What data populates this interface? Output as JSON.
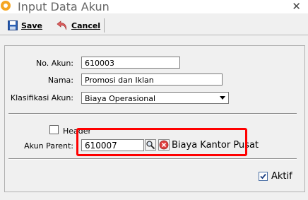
{
  "window": {
    "title": "Input Data Akun",
    "close_glyph": "✕"
  },
  "toolbar": {
    "save_label": "Save",
    "cancel_label": "Cancel"
  },
  "form": {
    "no_akun_label": "No. Akun:",
    "no_akun_value": "610003",
    "nama_label": "Nama:",
    "nama_value": "Promosi dan Iklan",
    "klasifikasi_label": "Klasifikasi Akun:",
    "klasifikasi_value": "Biaya Operasional",
    "header_label": "Header",
    "header_checked": false,
    "parent_label": "Akun Parent:",
    "parent_value": "610007",
    "parent_name": "Biaya Kantor Pusat",
    "aktif_label": "Aktif",
    "aktif_checked": true
  },
  "colors": {
    "highlight": "#ff0000",
    "app_icon": "#f5a623"
  }
}
